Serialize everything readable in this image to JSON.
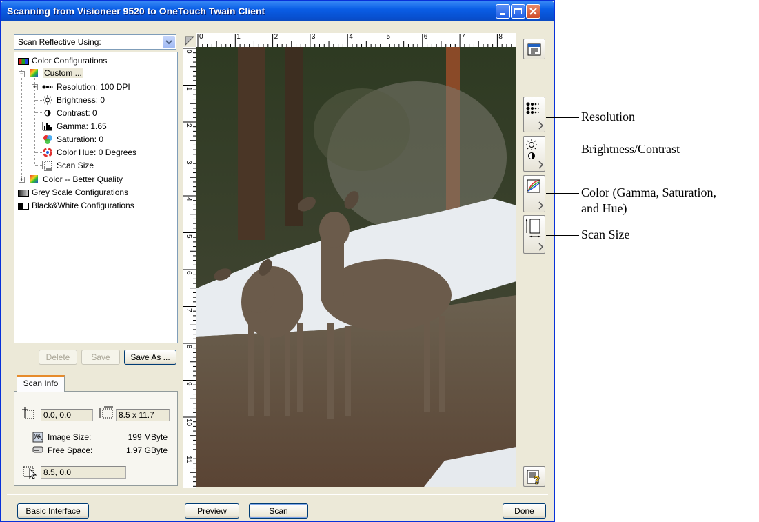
{
  "window": {
    "title": "Scanning from Visioneer 9520 to OneTouch Twain Client"
  },
  "source_combo": {
    "value": "Scan Reflective Using:"
  },
  "tree": {
    "color_configurations": "Color Configurations",
    "custom": "Custom ...",
    "resolution": "Resolution: 100 DPI",
    "brightness": "Brightness: 0",
    "contrast": "Contrast: 0",
    "gamma": "Gamma: 1.65",
    "saturation": "Saturation: 0",
    "color_hue": "Color Hue: 0 Degrees",
    "scan_size": "Scan Size",
    "color_better_quality": "Color -- Better Quality",
    "grey_scale": "Grey Scale Configurations",
    "black_white": "Black&White Configurations",
    "expand_symbol": "+",
    "collapse_symbol": "−"
  },
  "config_buttons": {
    "delete": "Delete",
    "save": "Save",
    "save_as": "Save As ..."
  },
  "scan_info": {
    "tab_label": "Scan Info",
    "origin": "0.0, 0.0",
    "size": "8.5 x 11.7",
    "image_size_label": "Image Size:",
    "image_size_value": "199 MByte",
    "free_space_label": "Free Space:",
    "free_space_value": "1.97 GByte",
    "cursor_position": "8.5, 0.0"
  },
  "ruler": {
    "horizontal_labels": [
      "0",
      "1",
      "2",
      "3",
      "4",
      "5",
      "6",
      "7",
      "8"
    ],
    "vertical_labels": [
      "0",
      "1",
      "2",
      "3",
      "4",
      "5",
      "6",
      "7",
      "8",
      "9",
      "10",
      "11"
    ]
  },
  "bottom_buttons": {
    "basic_interface": "Basic Interface",
    "preview": "Preview",
    "scan": "Scan",
    "done": "Done"
  },
  "callouts": {
    "resolution": "Resolution",
    "brightness_contrast": "Brightness/Contrast",
    "color_line1": "Color (Gamma, Saturation,",
    "color_line2": "and Hue)",
    "scan_size": "Scan Size"
  },
  "colors": {
    "title_bar": "#0a5ee6",
    "window_bg": "#ece9d8",
    "tab_accent": "#e68b2c"
  }
}
